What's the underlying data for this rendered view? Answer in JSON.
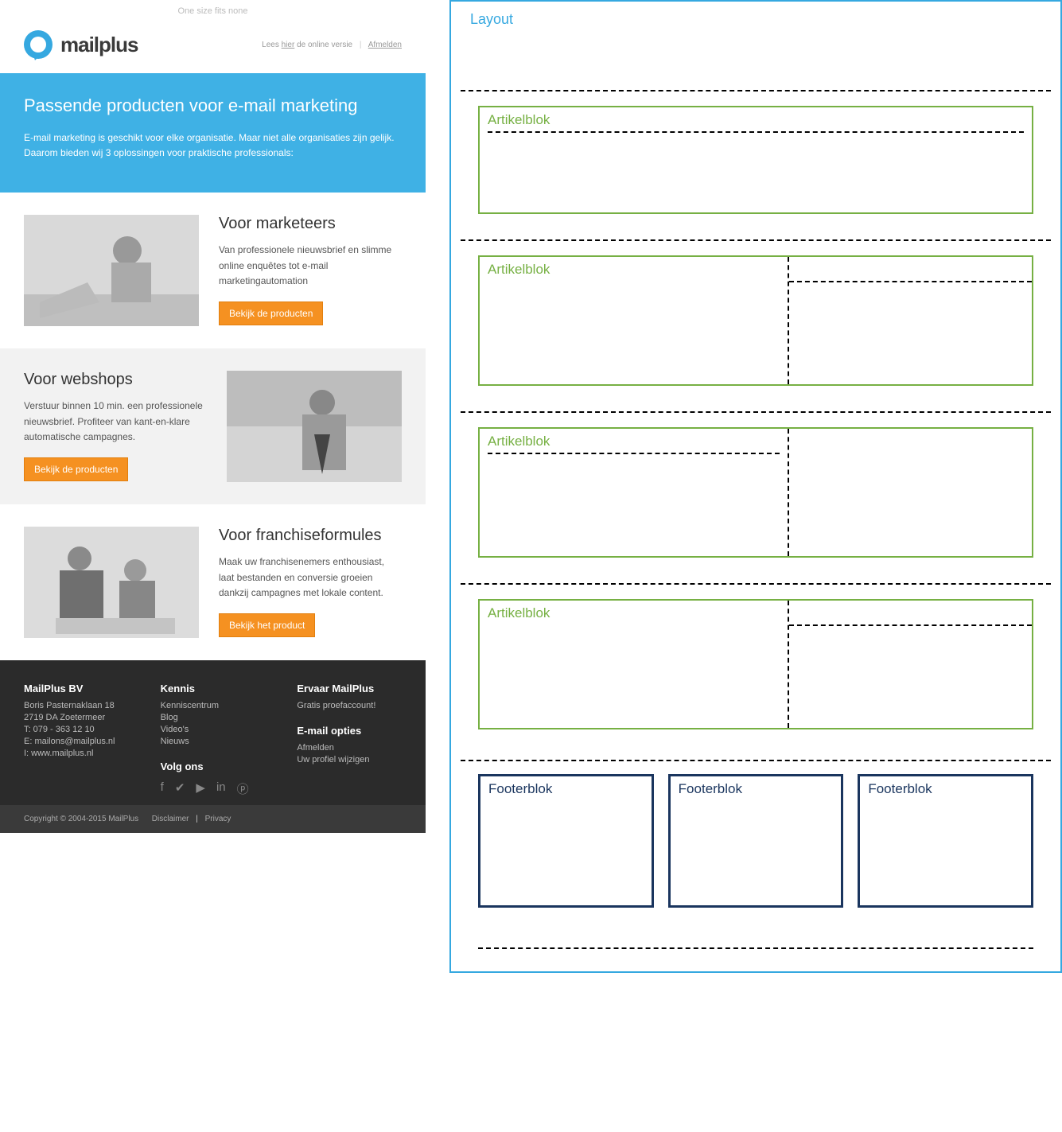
{
  "preheader": "One size fits none",
  "logo_text": "mailplus",
  "meta": {
    "lees": "Lees",
    "hier": "hier",
    "rest": "de online versie",
    "afmelden": "Afmelden"
  },
  "hero": {
    "title": "Passende producten voor e-mail marketing",
    "body": "E-mail marketing is geschikt voor elke organisatie. Maar niet alle organisaties zijn gelijk. Daarom bieden wij 3 oplossingen voor praktische professionals:"
  },
  "s1": {
    "title": "Voor marketeers",
    "body": "Van professionele nieuwsbrief en slimme online enquêtes tot e-mail marketingautomation",
    "btn": "Bekijk de producten"
  },
  "s2": {
    "title": "Voor webshops",
    "body": "Verstuur binnen 10 min. een professionele nieuwsbrief. Profiteer van kant-en-klare automatische campagnes.",
    "btn": "Bekijk de producten"
  },
  "s3": {
    "title": "Voor franchiseformules",
    "body": "Maak uw franchisenemers enthousiast, laat bestanden en conversie groeien dankzij campagnes met lokale content.",
    "btn": "Bekijk het product"
  },
  "footer": {
    "c1": {
      "h": "MailPlus BV",
      "l1": "Boris Pasternaklaan 18",
      "l2": "2719 DA Zoetermeer",
      "l3": "T: 079 - 363 12 10",
      "l4": "E: mailons@mailplus.nl",
      "l5": "I: www.mailplus.nl"
    },
    "c2": {
      "h": "Kennis",
      "l1": "Kenniscentrum",
      "l2": "Blog",
      "l3": "Video's",
      "l4": "Nieuws",
      "h2": "Volg ons"
    },
    "c3": {
      "h": "Ervaar MailPlus",
      "l1": "Gratis proefaccount!",
      "h2": "E-mail opties",
      "l2": "Afmelden",
      "l3": "Uw profiel wijzigen"
    }
  },
  "copyright": {
    "text": "Copyright © 2004-2015 MailPlus",
    "disclaimer": "Disclaimer",
    "privacy": "Privacy"
  },
  "diagram": {
    "layout": "Layout",
    "artikel": "Artikelblok",
    "footer": "Footerblok"
  }
}
